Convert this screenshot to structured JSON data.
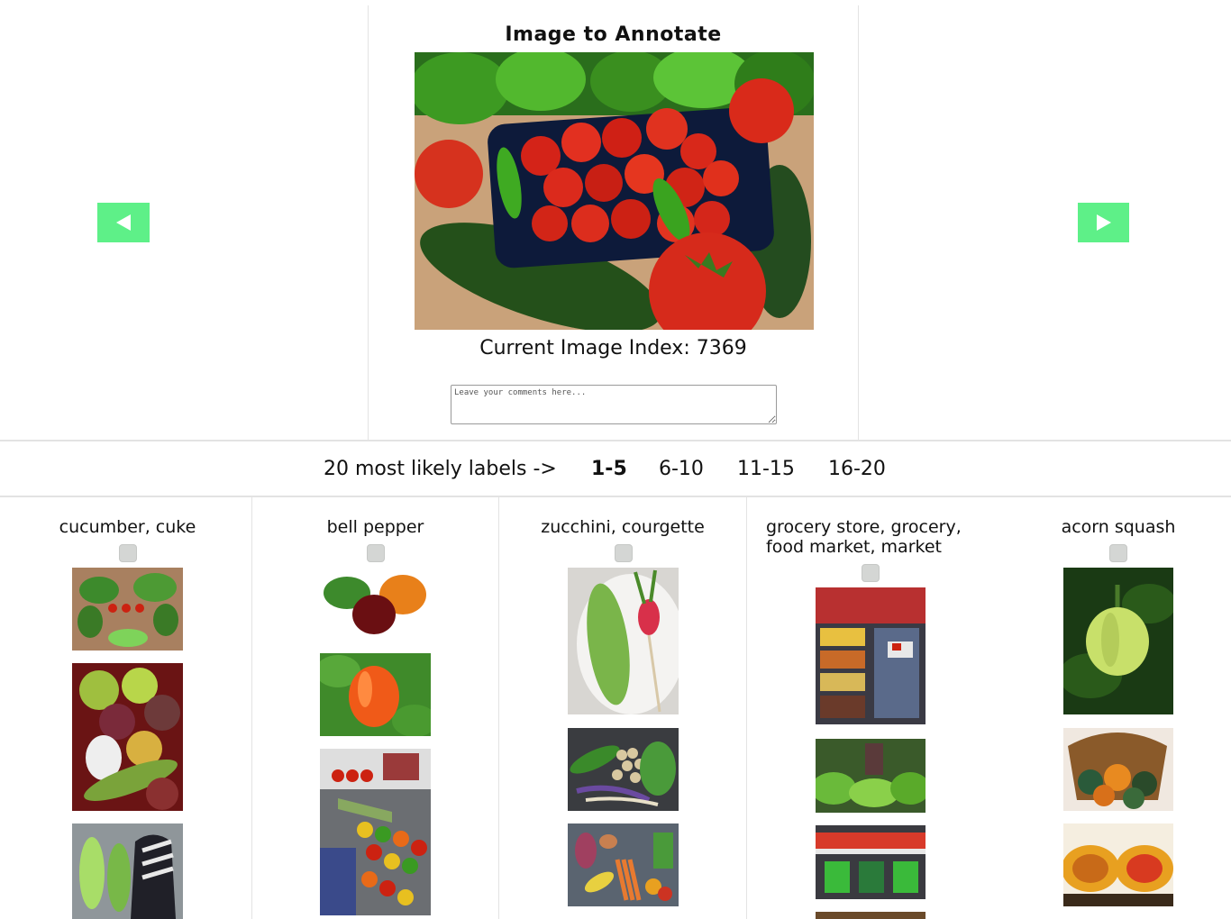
{
  "header": {
    "title": "Image to Annotate",
    "index_text": "Current Image Index: 7369",
    "comment_placeholder": "Leave your comments here..."
  },
  "nav": {
    "prev_icon": "left-triangle-icon",
    "next_icon": "right-triangle-icon",
    "accent_color": "#5ef088"
  },
  "pager": {
    "label": "20 most likely labels ->",
    "pages": [
      "1-5",
      "6-10",
      "11-15",
      "16-20"
    ],
    "active": "1-5"
  },
  "labels": [
    {
      "name": "cucumber, cuke"
    },
    {
      "name": "bell pepper"
    },
    {
      "name": "zucchini, courgette"
    },
    {
      "name": "grocery store, grocery, food market, market"
    },
    {
      "name": "acorn squash"
    }
  ]
}
